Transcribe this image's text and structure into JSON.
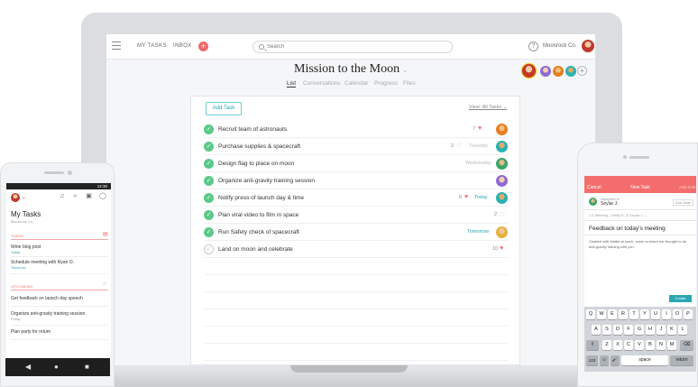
{
  "laptop": {
    "nav": {
      "my_tasks": "MY TASKS",
      "inbox": "INBOX",
      "add_icon": "+"
    },
    "search": {
      "placeholder": "Search"
    },
    "help_icon": "?",
    "org": "Moonrock Co.",
    "project": {
      "title": "Mission to the Moon",
      "title_chevron": "⌄"
    },
    "tabs": [
      {
        "label": "List",
        "active": true
      },
      {
        "label": "Conversations",
        "active": false
      },
      {
        "label": "Calendar",
        "active": false
      },
      {
        "label": "Progress",
        "active": false
      },
      {
        "label": "Files",
        "active": false
      }
    ],
    "member_add": "+",
    "add_task_label": "Add Task",
    "view_filter": "View: All Tasks ⌄",
    "tasks": [
      {
        "name": "Recruit team of astronauts",
        "likes": "7",
        "liked": true,
        "due": "",
        "done": true,
        "assignee": "av-orange"
      },
      {
        "name": "Purchase supplies & spacecraft",
        "likes": "2",
        "liked": false,
        "due": "Tuesday",
        "done": true,
        "assignee": "av-teal"
      },
      {
        "name": "Design flag to place on moon",
        "likes": "",
        "liked": false,
        "due": "Wednesday",
        "done": true,
        "assignee": "av-green"
      },
      {
        "name": "Organize anti-gravity training session",
        "likes": "",
        "liked": false,
        "due": "",
        "done": true,
        "assignee": "av-purple"
      },
      {
        "name": "Notify press of launch day & time",
        "likes": "6",
        "liked": true,
        "due": "Today",
        "done": true,
        "assignee": "av-teal"
      },
      {
        "name": "Plan viral video to film in space",
        "likes": "2",
        "liked": false,
        "due": "",
        "done": true,
        "assignee": ""
      },
      {
        "name": "Run Safety check of spacecraft",
        "likes": "",
        "liked": false,
        "due": "Tomorrow",
        "done": true,
        "assignee": "av-gold"
      },
      {
        "name": "Land on moon and celebrate",
        "likes": "10",
        "liked": true,
        "due": "",
        "done": false,
        "assignee": "av-red"
      }
    ],
    "colors": {
      "accent": "#f06a6a",
      "check": "#5ac987",
      "teal": "#2aa6b4"
    }
  },
  "android": {
    "status_time": "12:30",
    "title": "My Tasks",
    "org": "Moonrock Co.",
    "today_label": "TODAY",
    "upcoming_label": "UPCOMING",
    "today_items": [
      {
        "name": "Write blog post",
        "meta": "Today"
      },
      {
        "name": "Schedule meeting with Ryan O.",
        "meta": "Tomorrow"
      }
    ],
    "upcoming_items": [
      {
        "name": "Get feedback on launch day speech",
        "meta": ""
      },
      {
        "name": "Organize anti-gravity training session",
        "meta": "Friday"
      },
      {
        "name": "Plan party for return",
        "meta": ""
      }
    ],
    "fab": "+",
    "nav": {
      "back": "◀",
      "home": "●",
      "recent": "■"
    }
  },
  "iphone": {
    "cancel": "Cancel",
    "header_title": "New Task",
    "header_right": "Add Subt",
    "assignee_label": "Assigned to",
    "assignee": "Seylar J.",
    "tag": "Due Date",
    "meta": "1:1 Meeting – Emily K. & Seylar J. ⌄",
    "task_title": "Feedback on today's meeting",
    "description": "Chatted with Mattie at lunch, seem to share her thought to do anti-gravity training with you.",
    "create_label": "Create",
    "keyboard": {
      "row1": [
        "Q",
        "W",
        "E",
        "R",
        "T",
        "Y",
        "U",
        "I",
        "O",
        "P"
      ],
      "row2": [
        "A",
        "S",
        "D",
        "F",
        "G",
        "H",
        "J",
        "K",
        "L"
      ],
      "row3": [
        "Z",
        "X",
        "C",
        "V",
        "B",
        "N",
        "M"
      ],
      "shift": "⇧",
      "backspace": "⌫",
      "num": "123",
      "emoji": "☺",
      "mic": "🎤",
      "space": "space",
      "return": "return"
    }
  }
}
